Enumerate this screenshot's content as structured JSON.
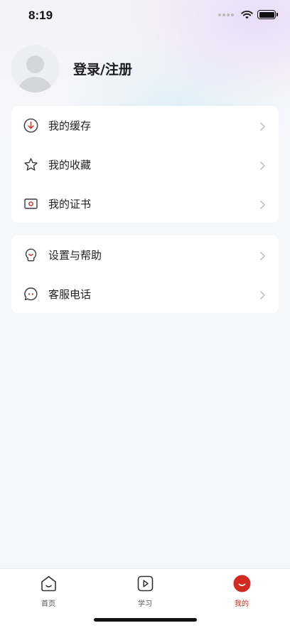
{
  "status_bar": {
    "time": "8:19"
  },
  "profile": {
    "name": "登录/注册"
  },
  "menu_group_1": [
    {
      "label": "我的缓存",
      "icon": "download-circle-icon"
    },
    {
      "label": "我的收藏",
      "icon": "star-icon"
    },
    {
      "label": "我的证书",
      "icon": "certificate-icon"
    }
  ],
  "menu_group_2": [
    {
      "label": "设置与帮助",
      "icon": "lightbulb-icon"
    },
    {
      "label": "客服电话",
      "icon": "chat-bubble-icon"
    }
  ],
  "tab_bar": {
    "items": [
      {
        "label": "首页",
        "icon": "home-icon",
        "active": false
      },
      {
        "label": "学习",
        "icon": "play-icon",
        "active": false
      },
      {
        "label": "我的",
        "icon": "profile-smile-icon",
        "active": true
      }
    ]
  },
  "colors": {
    "accent": "#d32a1f",
    "icon_stroke": "#3a3a3a",
    "chevron": "#c4c4c4"
  }
}
